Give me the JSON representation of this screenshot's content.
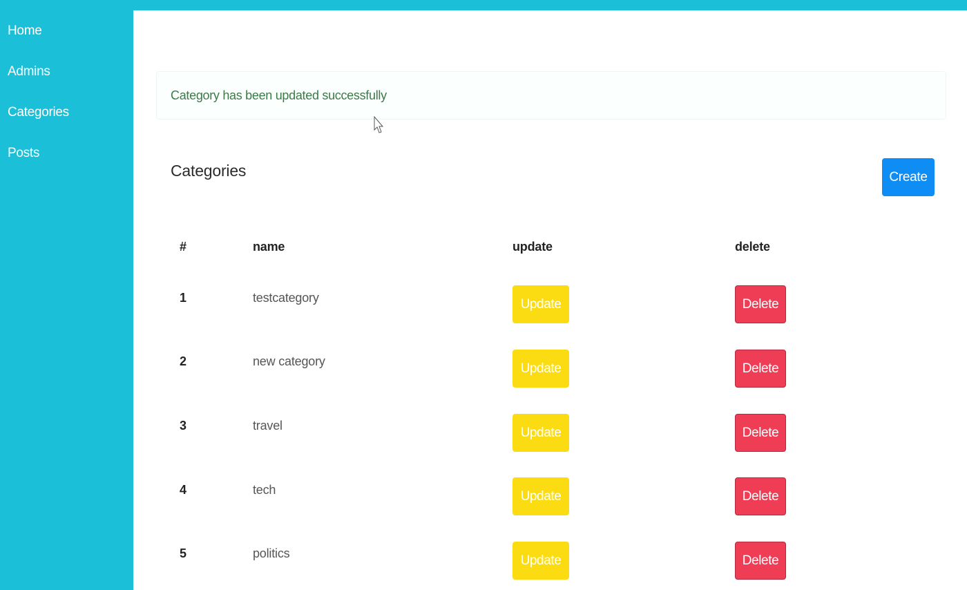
{
  "sidebar": {
    "items": [
      {
        "label": "Home"
      },
      {
        "label": "Admins"
      },
      {
        "label": "Categories"
      },
      {
        "label": "Posts"
      }
    ]
  },
  "alert": {
    "message": "Category has been updated successfully"
  },
  "page": {
    "title": "Categories",
    "create_label": "Create"
  },
  "table": {
    "headers": [
      "#",
      "name",
      "update",
      "delete"
    ],
    "rows": [
      {
        "id": "1",
        "name": "testcategory",
        "update_label": "Update",
        "delete_label": "Delete"
      },
      {
        "id": "2",
        "name": "new category",
        "update_label": "Update",
        "delete_label": "Delete"
      },
      {
        "id": "3",
        "name": "travel",
        "update_label": "Update",
        "delete_label": "Delete"
      },
      {
        "id": "4",
        "name": "tech",
        "update_label": "Update",
        "delete_label": "Delete"
      },
      {
        "id": "5",
        "name": "politics",
        "update_label": "Update",
        "delete_label": "Delete"
      }
    ]
  },
  "colors": {
    "sidebar": "#1bbfd8",
    "primary": "#0e8ef5",
    "warning": "#fbdc13",
    "danger": "#ef3d56",
    "success_text": "#3b7a47"
  }
}
